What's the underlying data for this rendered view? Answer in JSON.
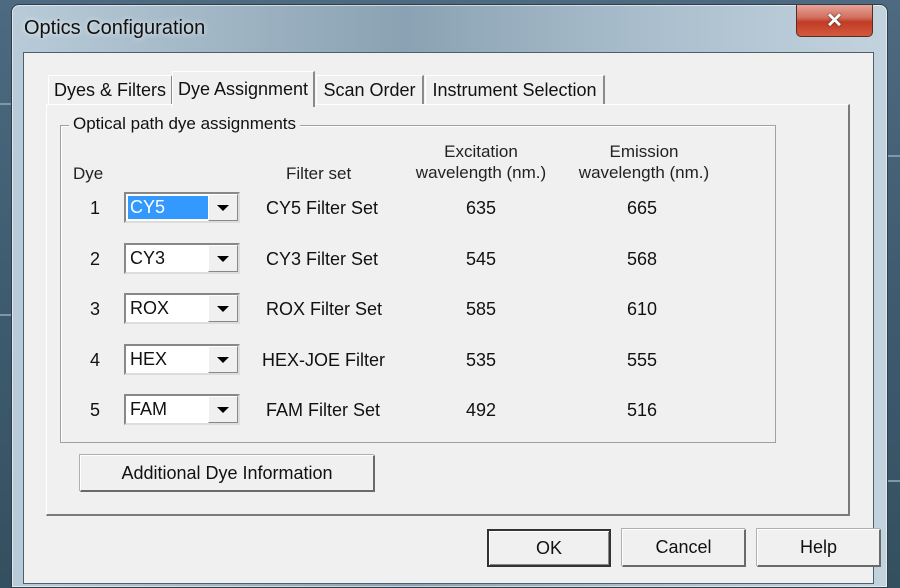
{
  "window": {
    "title": "Optics Configuration",
    "close_glyph": "✕"
  },
  "tabs": [
    {
      "label": "Dyes & Filters",
      "active": false
    },
    {
      "label": "Dye Assignment",
      "active": true
    },
    {
      "label": "Scan Order",
      "active": false
    },
    {
      "label": "Instrument Selection",
      "active": false
    }
  ],
  "group": {
    "title": "Optical path dye assignments",
    "headers": {
      "dye": "Dye",
      "filter_set": "Filter set",
      "excitation_line1": "Excitation",
      "excitation_line2": "wavelength (nm.)",
      "emission_line1": "Emission",
      "emission_line2": "wavelength (nm.)"
    },
    "rows": [
      {
        "dye": "1",
        "selected_dye": "CY5",
        "filter_set": "CY5 Filter Set",
        "excitation": "635",
        "emission": "665",
        "focused": true
      },
      {
        "dye": "2",
        "selected_dye": "CY3",
        "filter_set": "CY3 Filter Set",
        "excitation": "545",
        "emission": "568",
        "focused": false
      },
      {
        "dye": "3",
        "selected_dye": "ROX",
        "filter_set": "ROX Filter Set",
        "excitation": "585",
        "emission": "610",
        "focused": false
      },
      {
        "dye": "4",
        "selected_dye": "HEX",
        "filter_set": "HEX-JOE Filter",
        "excitation": "535",
        "emission": "555",
        "focused": false
      },
      {
        "dye": "5",
        "selected_dye": "FAM",
        "filter_set": "FAM Filter Set",
        "excitation": "492",
        "emission": "516",
        "focused": false
      }
    ]
  },
  "buttons": {
    "additional_info": "Additional Dye Information",
    "ok": "OK",
    "cancel": "Cancel",
    "help": "Help"
  },
  "colors": {
    "selection": "#3399ff",
    "close_button": "#c23b25",
    "dialog_bg": "#f0f0f0"
  }
}
